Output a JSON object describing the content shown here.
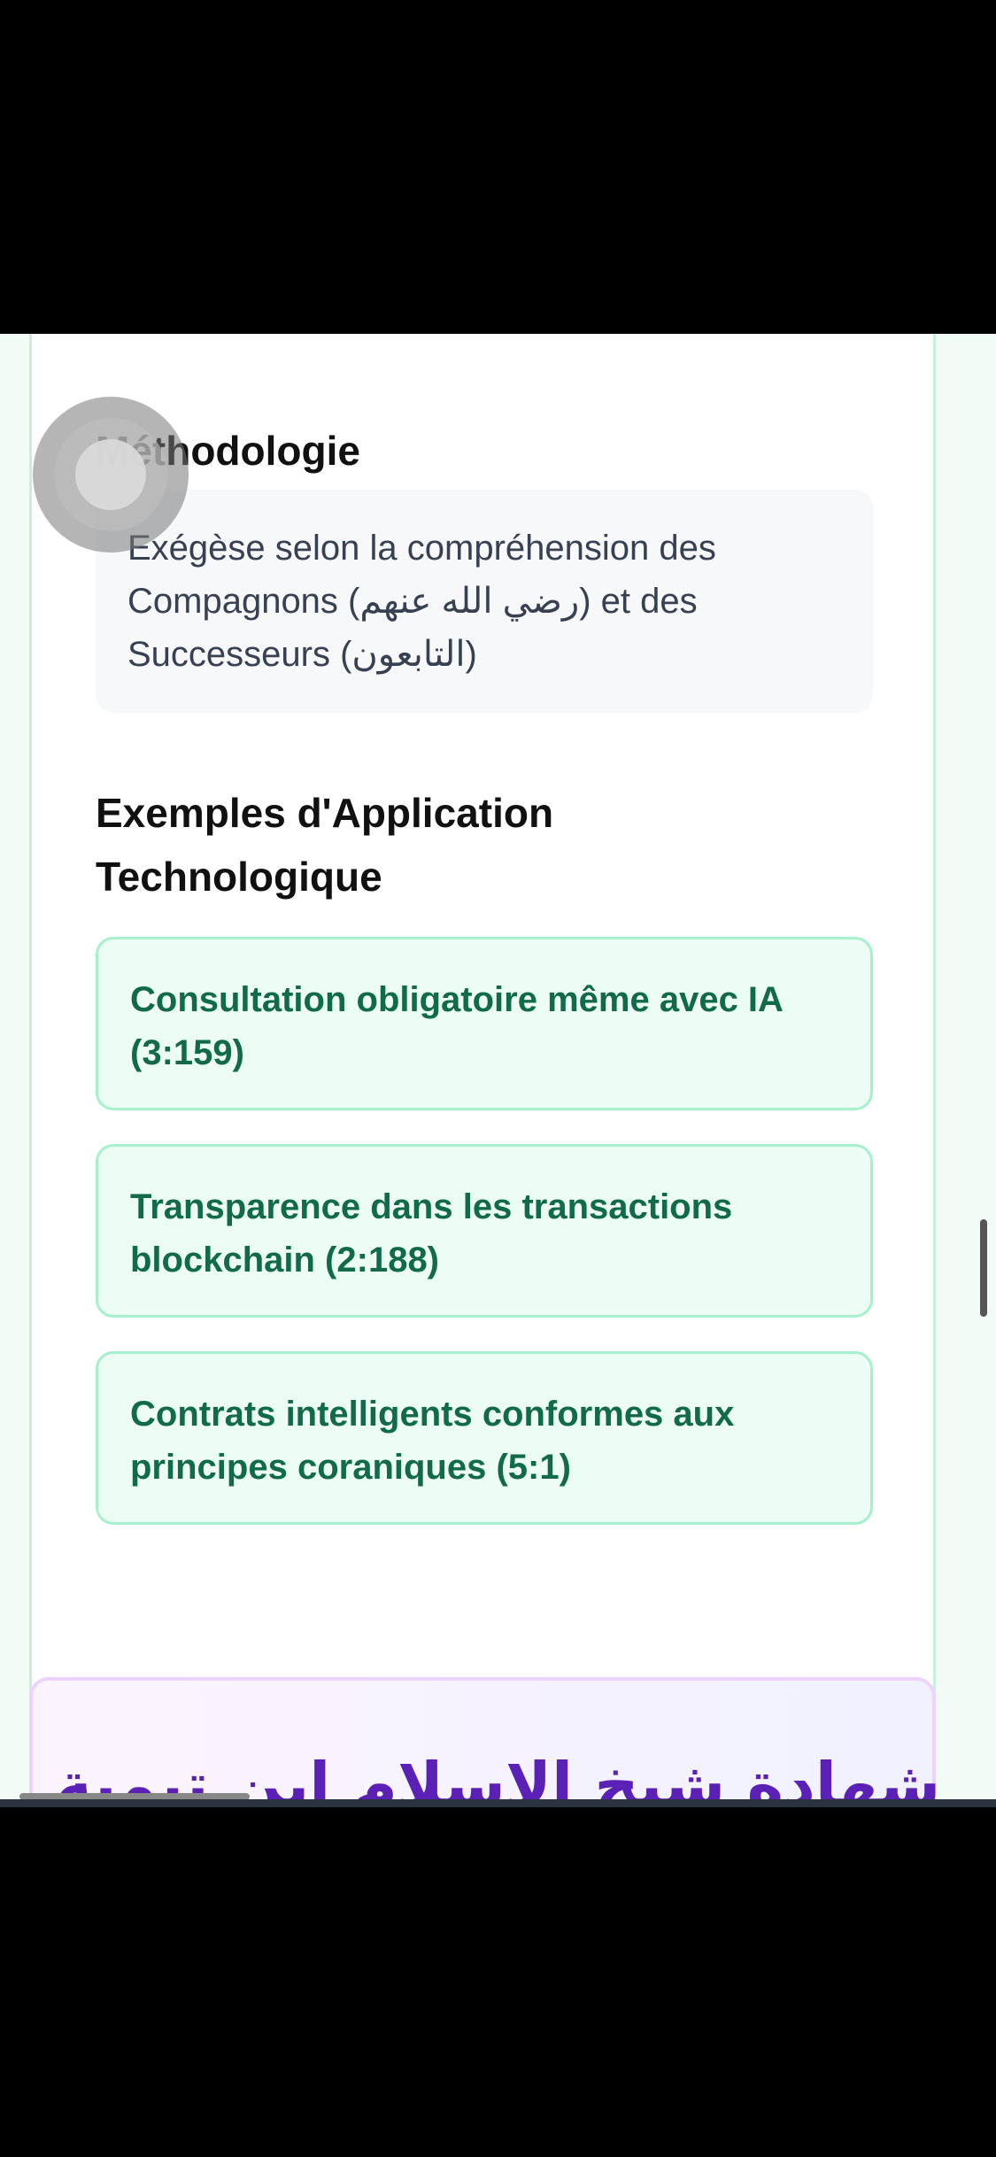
{
  "methodology": {
    "title": "Méthodologie",
    "text": "Exégèse selon la compréhension des Compagnons (رضي الله عنهم) et des Successeurs (التابعون)"
  },
  "examples": {
    "title": "Exemples d'Application Technologique",
    "items": [
      "Consultation obligatoire même avec IA (3:159)",
      "Transparence dans les transactions blockchain (2:188)",
      "Contrats intelligents conformes aux principes coraniques (5:1)"
    ]
  },
  "next_card": {
    "title": "شهادة شيخ الاسلام ابن تيمية"
  },
  "colors": {
    "accent_green": "#116a4a",
    "card_border": "#c4f0dc",
    "purple_title": "#5b21b6"
  }
}
